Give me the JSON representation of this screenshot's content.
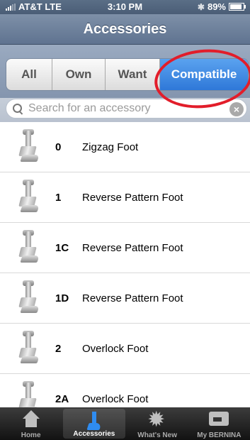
{
  "status_bar": {
    "carrier": "AT&T",
    "network": "LTE",
    "time": "3:10 PM",
    "battery_text": "89%",
    "battery_level": 0.89,
    "bluetooth_icon": "bluetooth-icon"
  },
  "navbar": {
    "title": "Accessories"
  },
  "filter_tabs": {
    "options": [
      "All",
      "Own",
      "Want",
      "Compatible"
    ],
    "selected": "Compatible"
  },
  "search": {
    "placeholder": "Search for an accessory"
  },
  "accessories": [
    {
      "number": "0",
      "name": "Zigzag Foot"
    },
    {
      "number": "1",
      "name": "Reverse Pattern Foot"
    },
    {
      "number": "1C",
      "name": "Reverse Pattern Foot"
    },
    {
      "number": "1D",
      "name": "Reverse Pattern Foot"
    },
    {
      "number": "2",
      "name": "Overlock Foot"
    },
    {
      "number": "2A",
      "name": "Overlock Foot"
    }
  ],
  "tab_bar": {
    "tabs": [
      {
        "label": "Home",
        "icon": "home-icon"
      },
      {
        "label": "Accessories",
        "icon": "presser-foot-icon"
      },
      {
        "label": "What's New",
        "icon": "starburst-icon"
      },
      {
        "label": "My BERNINA",
        "icon": "sewing-machine-icon"
      }
    ],
    "selected": "Accessories"
  },
  "colors": {
    "nav_blue": "#6b7f9b",
    "active_segment": "#3b84e0",
    "annotation_red": "#e21d2a"
  }
}
